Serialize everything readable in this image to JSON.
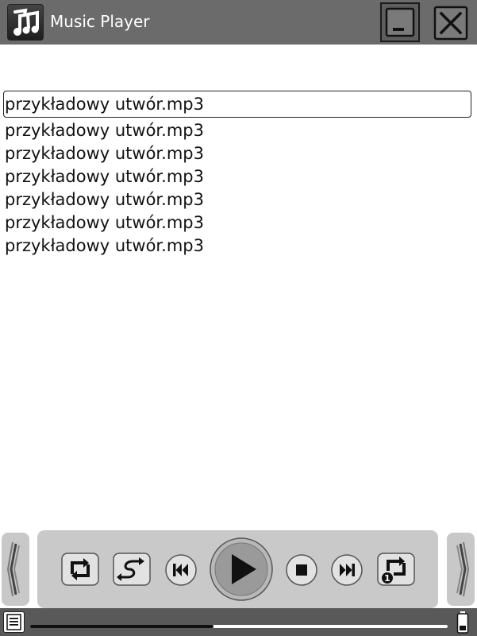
{
  "window": {
    "title": "Music Player",
    "icons": {
      "app": "music-notes-icon",
      "minimize": "minimize-icon",
      "close": "close-icon"
    }
  },
  "playlist": {
    "selected_index": 0,
    "tracks": [
      "przykładowy utwór.mp3",
      "przykładowy utwór.mp3",
      "przykładowy utwór.mp3",
      "przykładowy utwór.mp3",
      "przykładowy utwór.mp3",
      "przykładowy utwór.mp3",
      "przykładowy utwór.mp3"
    ]
  },
  "controls": {
    "buttons": [
      "repeat-icon",
      "shuffle-icon",
      "previous-icon",
      "play-icon",
      "stop-icon",
      "next-icon",
      "repeat-one-icon"
    ],
    "scroll_left_icon": "left-arrow-icon",
    "scroll_right_icon": "right-arrow-icon"
  },
  "status": {
    "progress": 0.44,
    "menu_icon": "list-menu-icon",
    "battery_icon": "battery-icon"
  },
  "colors": {
    "titlebar": "#6b6b6b",
    "controls_bg": "#c9c9c9",
    "statusbar": "#595959"
  }
}
